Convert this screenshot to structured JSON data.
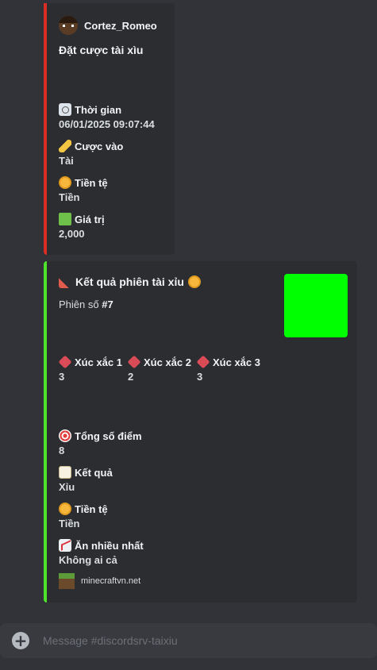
{
  "embed1": {
    "author": "Cortez_Romeo",
    "title": "Đặt cược tài xìu",
    "fields": [
      {
        "icon": "clock-icon",
        "name": "Thời gian",
        "value": "06/01/2025 09:07:44"
      },
      {
        "icon": "pencil-icon",
        "name": "Cược vào",
        "value": "Tài"
      },
      {
        "icon": "coin-icon",
        "name": "Tiền tệ",
        "value": "Tiền"
      },
      {
        "icon": "money-icon",
        "name": "Giá trị",
        "value": "2,000"
      }
    ]
  },
  "embed2": {
    "title": "Kết quả phiên tài xỉu",
    "session_label": "Phiên số",
    "session_number": "#7",
    "dice": [
      {
        "name": "Xúc xắc 1",
        "value": "3"
      },
      {
        "name": "Xúc xắc 2",
        "value": "2"
      },
      {
        "name": "Xúc xắc 3",
        "value": "3"
      }
    ],
    "fields": [
      {
        "icon": "target-icon",
        "name": "Tổng số điểm",
        "value": "8"
      },
      {
        "icon": "memo-icon",
        "name": "Kết quả",
        "value": "Xỉu"
      },
      {
        "icon": "coin-icon",
        "name": "Tiền tệ",
        "value": "Tiền"
      },
      {
        "icon": "chart-increasing-icon",
        "name": "Ăn nhiều nhất",
        "value": "Không ai cả"
      }
    ],
    "footer": "minecraftvn.net",
    "thumbnail_color": "#00ff00"
  },
  "composer": {
    "placeholder": "Message #discordsrv-taixiu"
  },
  "colors": {
    "embed1_accent": "#da2d24",
    "embed2_accent": "#4ee32b",
    "background": "#313338"
  }
}
